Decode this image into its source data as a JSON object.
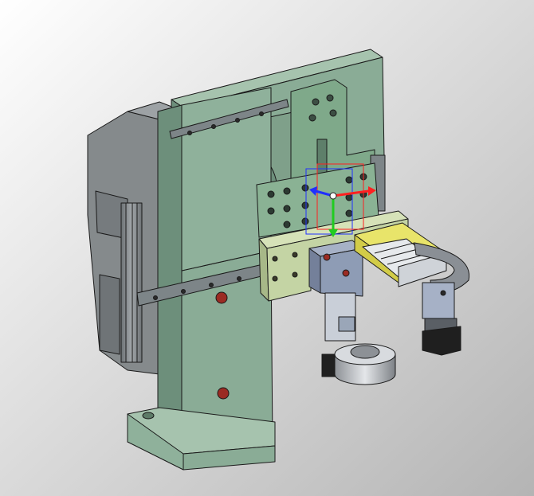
{
  "viewport": {
    "background_top": "#ffffff",
    "background_bottom": "#b4b4b4"
  },
  "colors": {
    "plate_green": "#8aac96",
    "plate_green_dark": "#6d8f7b",
    "plate_green_light": "#a6c3ae",
    "mount_green": "#7fa98a",
    "bracket_lime": "#c4d4a4",
    "rail_gray": "#7d8588",
    "motor_gray": "#858a8c",
    "block_blue": "#8e9cb5",
    "cylinder_yellow": "#e8e46a",
    "cylinder_silver": "#e6e9ec",
    "ring_silver": "#c9ccd0",
    "hole_red": "#9b2b23",
    "triad_x": "#ff2020",
    "triad_y": "#20cc20",
    "triad_z": "#2030ff",
    "edge": "#1a1a1a"
  },
  "manipulator": {
    "axes": [
      "x",
      "y",
      "z"
    ]
  }
}
